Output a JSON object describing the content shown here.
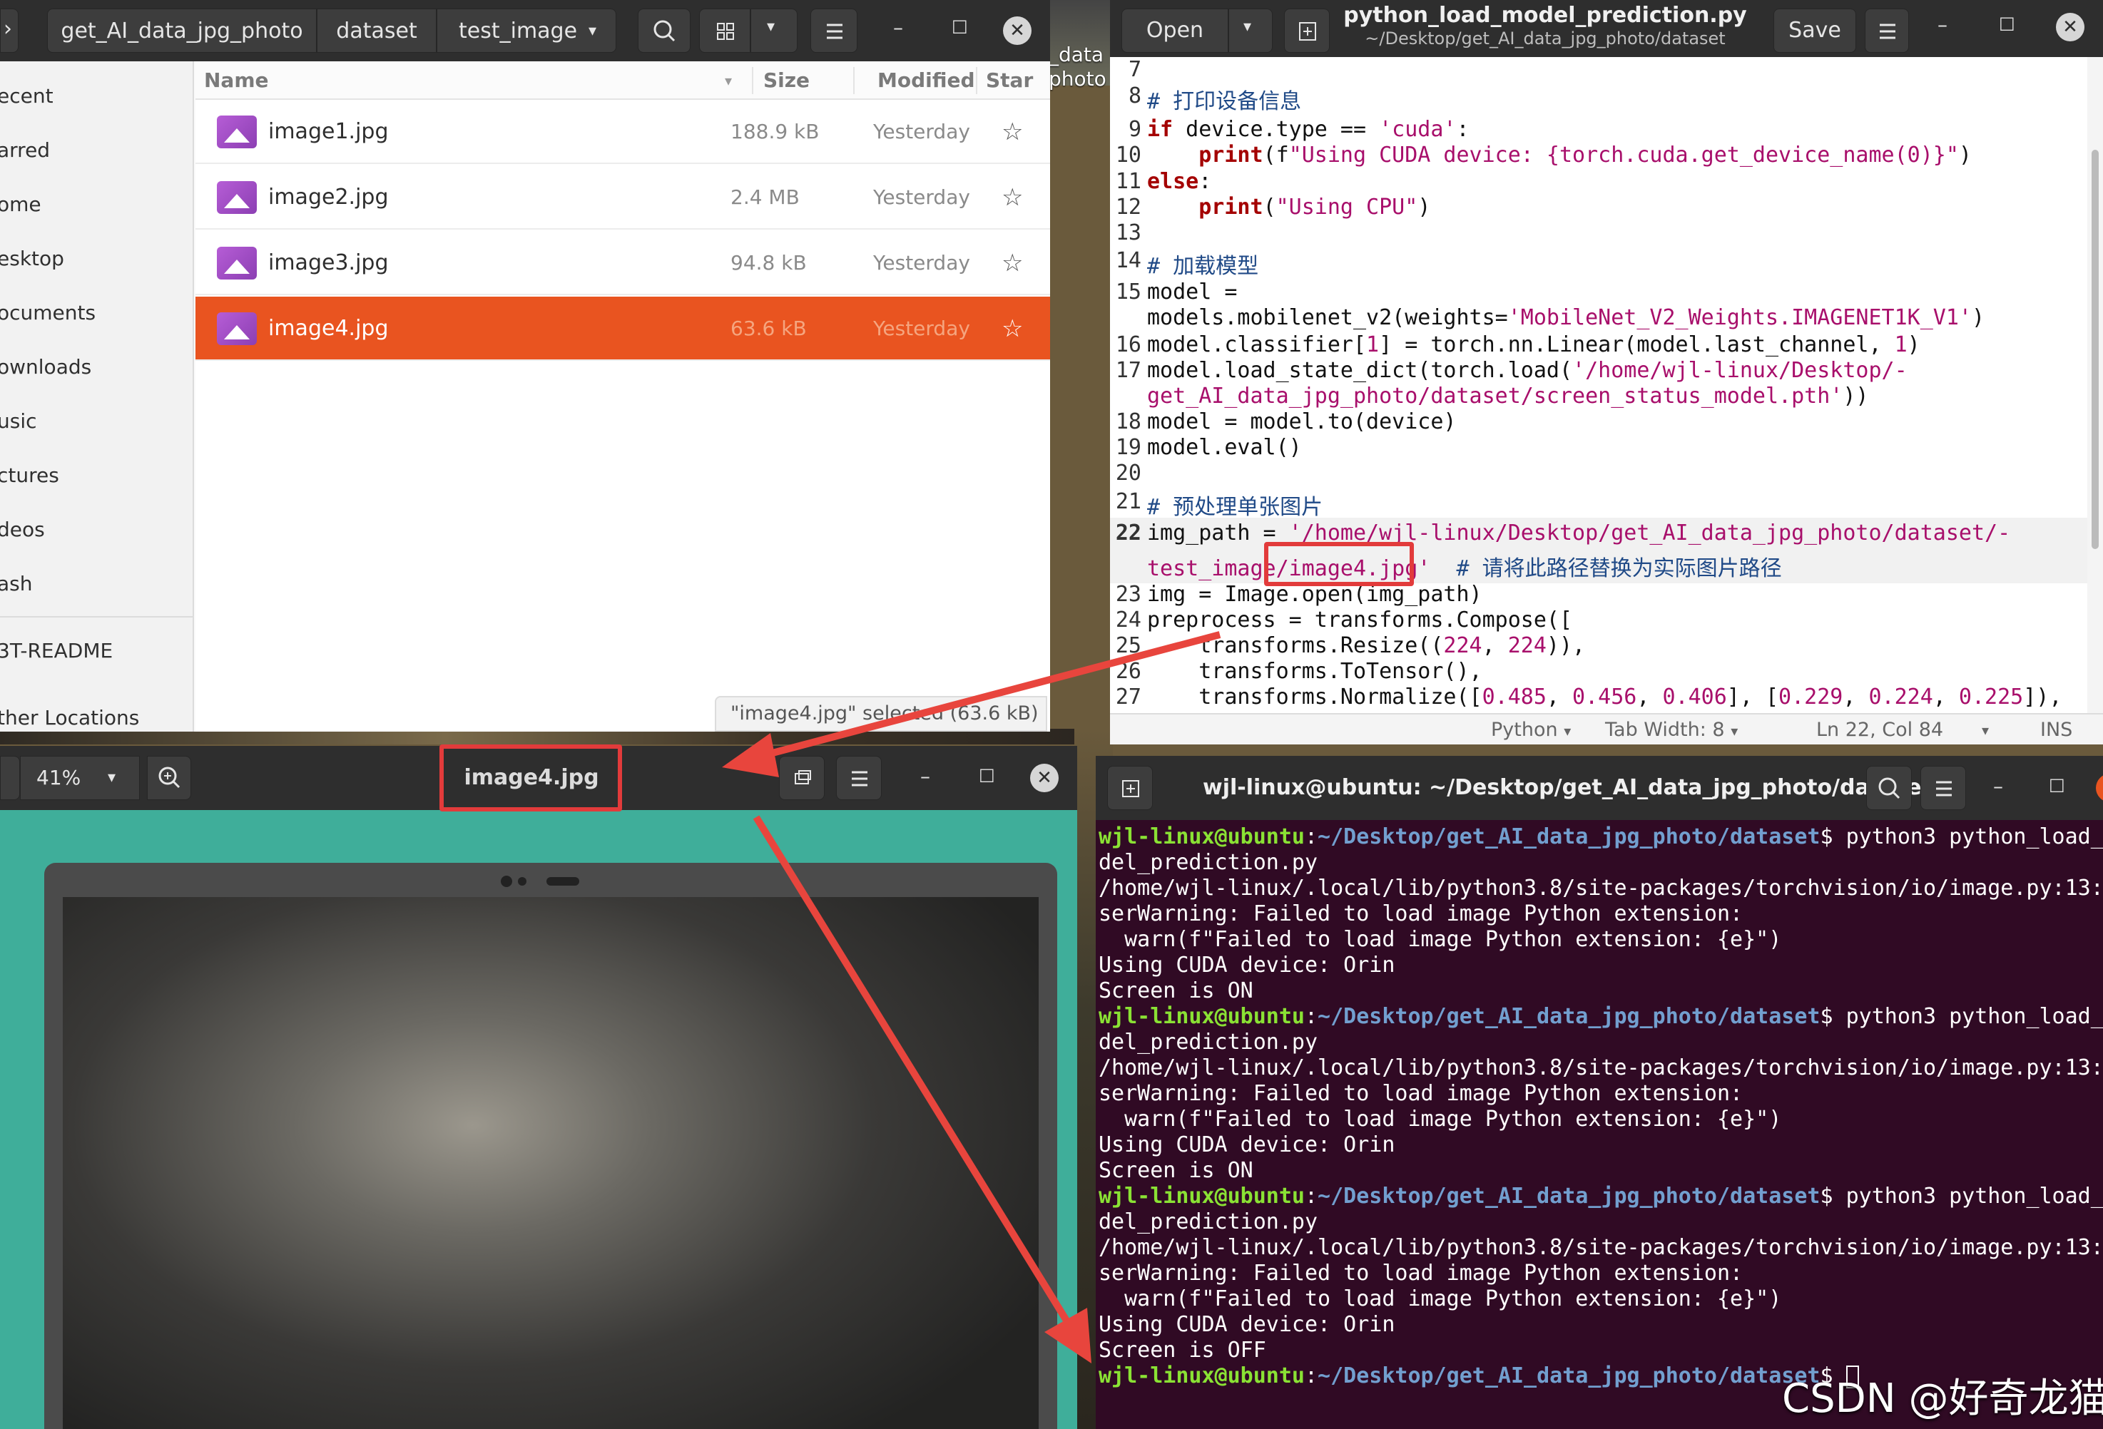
{
  "file_manager": {
    "breadcrumbs": [
      "get_AI_data_jpg_photo",
      "dataset",
      "test_image"
    ],
    "sidebar": [
      "ecent",
      "arred",
      "ome",
      "esktop",
      "ocuments",
      "ownloads",
      "usic",
      "ctures",
      "deos",
      "ash",
      "3T-README",
      "ther Locations"
    ],
    "columns": {
      "name": "Name",
      "size": "Size",
      "modified": "Modified",
      "star": "Star"
    },
    "files": [
      {
        "name": "image1.jpg",
        "size": "188.9 kB",
        "modified": "Yesterday"
      },
      {
        "name": "image2.jpg",
        "size": "2.4 MB",
        "modified": "Yesterday"
      },
      {
        "name": "image3.jpg",
        "size": "94.8 kB",
        "modified": "Yesterday"
      },
      {
        "name": "image4.jpg",
        "size": "63.6 kB",
        "modified": "Yesterday"
      }
    ],
    "status": "\"image4.jpg\" selected (63.6 kB)"
  },
  "desktop_label": "_data\nphoto",
  "editor": {
    "open_label": "Open",
    "save_label": "Save",
    "title": "python_load_model_prediction.py",
    "subtitle": "~/Desktop/get_AI_data_jpg_photo/dataset",
    "line_numbers": [
      "7",
      "8",
      "9",
      "10",
      "11",
      "12",
      "13",
      "14",
      "15",
      "",
      "16",
      "17",
      "",
      "18",
      "19",
      "20",
      "21",
      "22",
      "",
      "23",
      "24",
      "25",
      "26",
      "27"
    ],
    "status": {
      "language": "Python",
      "tab_width": "Tab Width: 8",
      "position": "Ln 22, Col 84",
      "mode": "INS"
    }
  },
  "image_viewer": {
    "zoom": "41%",
    "title": "image4.jpg"
  },
  "terminal": {
    "title": "wjl-linux@ubuntu: ~/Desktop/get_AI_data_jpg_photo/dataset",
    "user_host": "wjl-linux@ubuntu",
    "path": "~/Desktop/get_AI_data_jpg_photo/dataset",
    "lines": [
      {
        "type": "prompt",
        "cmd": "$ python3 python_load_"
      },
      {
        "type": "out",
        "text": "del_prediction.py"
      },
      {
        "type": "out",
        "text": "/home/wjl-linux/.local/lib/python3.8/site-packages/torchvision/io/image.py:13:"
      },
      {
        "type": "out",
        "text": "serWarning: Failed to load image Python extension:"
      },
      {
        "type": "out",
        "text": "  warn(f\"Failed to load image Python extension: {e}\")"
      },
      {
        "type": "out",
        "text": "Using CUDA device: Orin"
      },
      {
        "type": "out",
        "text": "Screen is ON"
      },
      {
        "type": "prompt",
        "cmd": "$ python3 python_load_"
      },
      {
        "type": "out",
        "text": "del_prediction.py"
      },
      {
        "type": "out",
        "text": "/home/wjl-linux/.local/lib/python3.8/site-packages/torchvision/io/image.py:13:"
      },
      {
        "type": "out",
        "text": "serWarning: Failed to load image Python extension:"
      },
      {
        "type": "out",
        "text": "  warn(f\"Failed to load image Python extension: {e}\")"
      },
      {
        "type": "out",
        "text": "Using CUDA device: Orin"
      },
      {
        "type": "out",
        "text": "Screen is ON"
      },
      {
        "type": "prompt",
        "cmd": "$ python3 python_load_"
      },
      {
        "type": "out",
        "text": "del_prediction.py"
      },
      {
        "type": "out",
        "text": "/home/wjl-linux/.local/lib/python3.8/site-packages/torchvision/io/image.py:13:"
      },
      {
        "type": "out",
        "text": "serWarning: Failed to load image Python extension:"
      },
      {
        "type": "out",
        "text": "  warn(f\"Failed to load image Python extension: {e}\")"
      },
      {
        "type": "out",
        "text": "Using CUDA device: Orin"
      },
      {
        "type": "out",
        "text": "Screen is OFF"
      },
      {
        "type": "prompt",
        "cmd": "$ "
      }
    ]
  },
  "watermark": "CSDN @好奇龙猫",
  "colors": {
    "accent": "#e95420",
    "annotation": "#e23b3b",
    "terminal_bg": "#300a24"
  }
}
